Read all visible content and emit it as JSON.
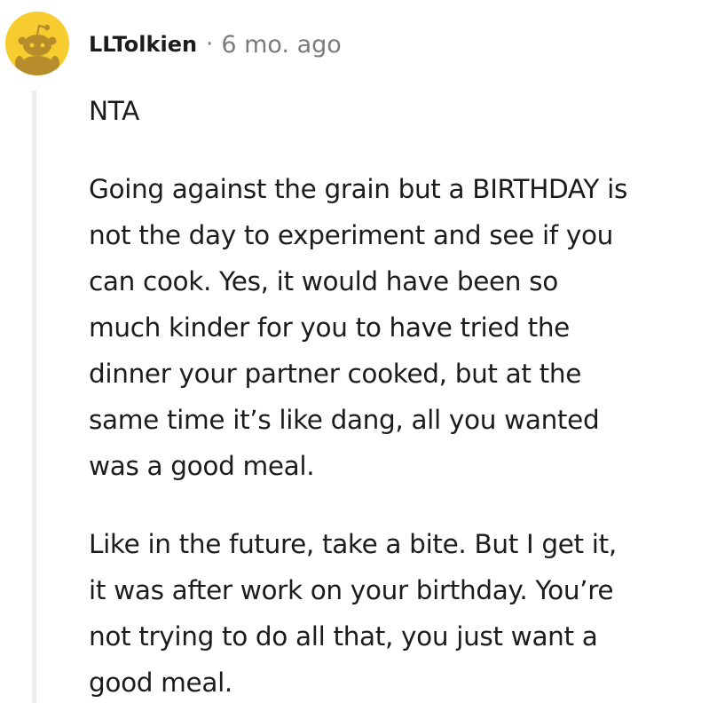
{
  "comment": {
    "author": "LLTolkien",
    "separator": "·",
    "timestamp": "6 mo. ago",
    "avatar_icon": "snoo-avatar-icon",
    "colors": {
      "avatar_bg": "#f6cc2e",
      "avatar_figure": "#b68d2a",
      "thread_line": "#ededed",
      "text": "#1c1c1c",
      "meta": "#7c7c7c"
    },
    "paragraphs": [
      {
        "lines": [
          "NTA"
        ]
      },
      {
        "lines": [
          "Going against the grain but a BIRTHDAY is",
          "not the day to experiment and see if you",
          "can cook. Yes, it would have been so",
          "much kinder for you to have tried the",
          "dinner your partner cooked, but at the",
          "same time it’s like dang, all you wanted",
          "was a good meal."
        ]
      },
      {
        "lines": [
          "Like in the future, take a bite. But I get it,",
          "it was after work on your birthday. You’re",
          "not trying to do all that, you just want a",
          "good meal."
        ]
      }
    ]
  }
}
